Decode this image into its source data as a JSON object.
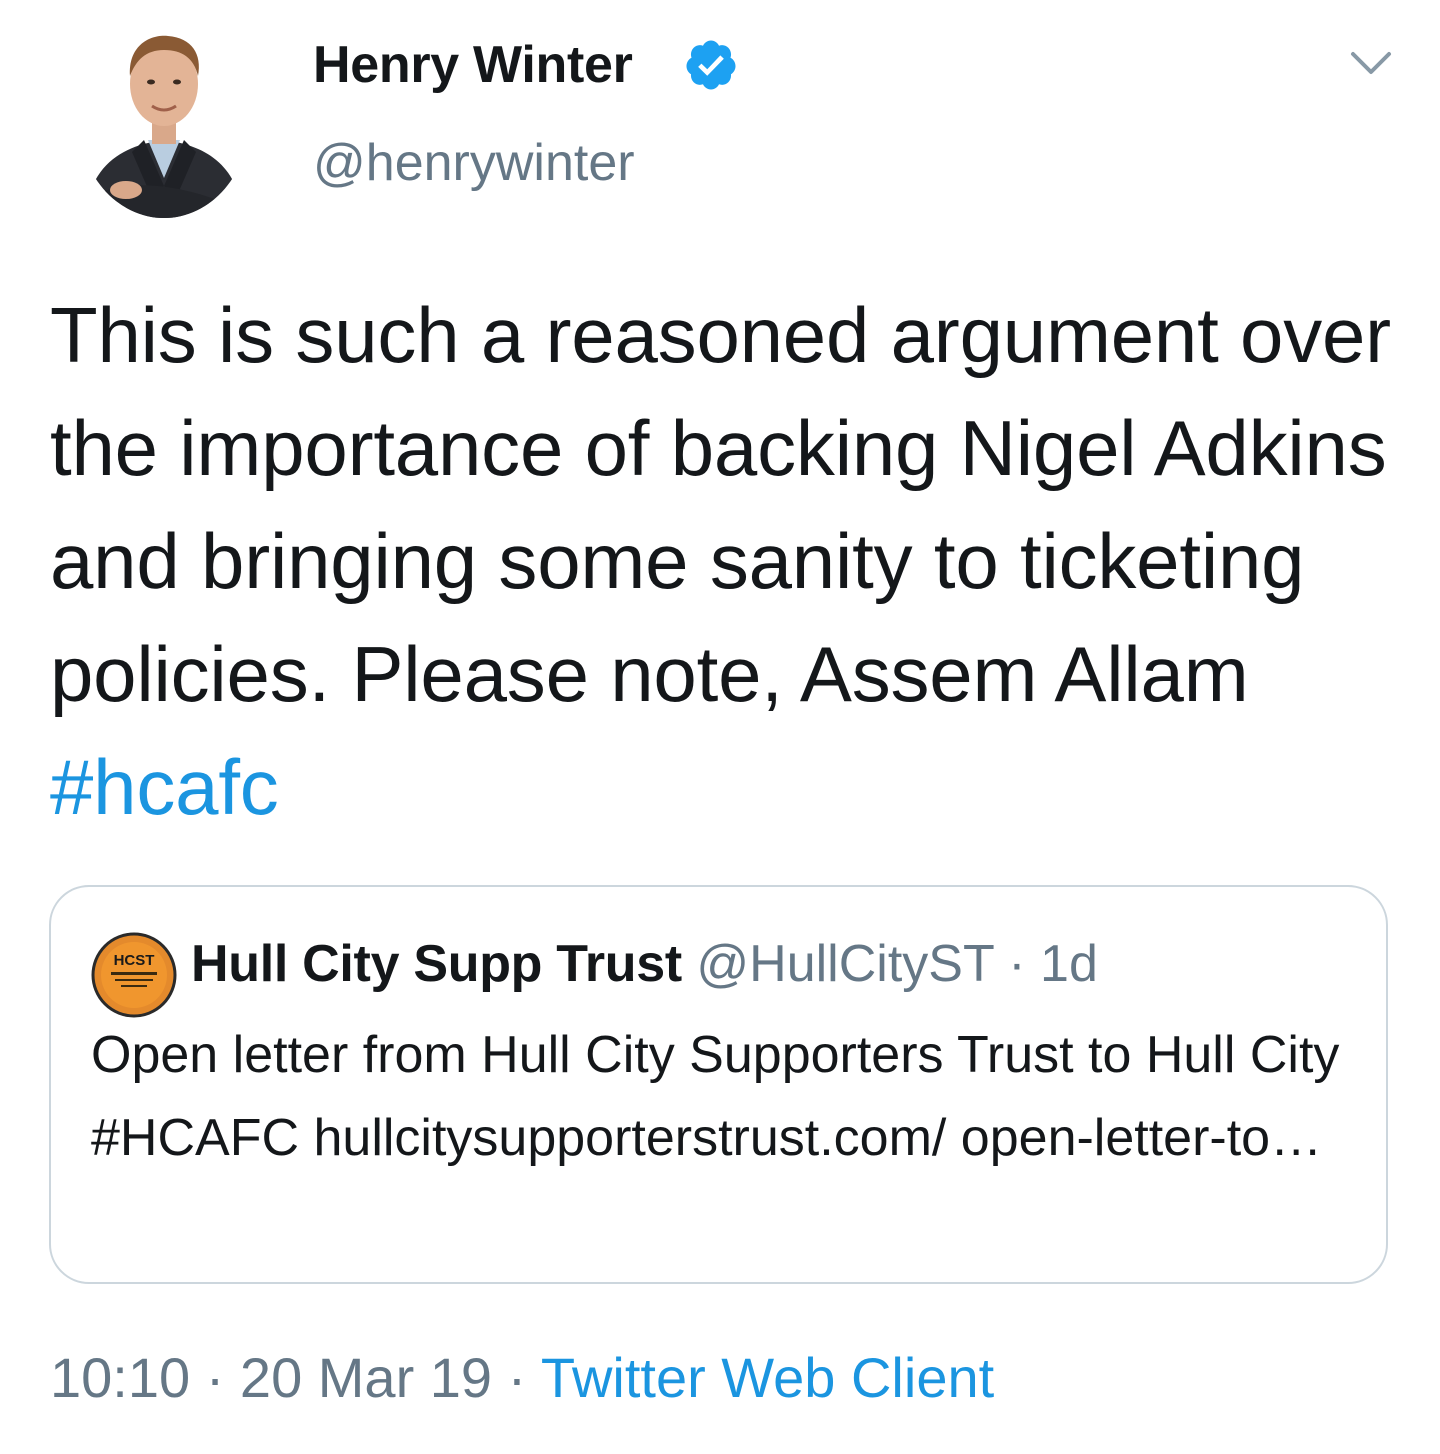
{
  "author": {
    "display_name": "Henry Winter",
    "handle": "@henrywinter",
    "verified": true,
    "avatar_icon": "person-photo-avatar"
  },
  "tweet": {
    "text": "This is such a reasoned argument over the importance of backing Nigel Adkins and bringing some sanity to ticketing policies. Please note, Assem Allam ",
    "hashtag": "#hcafc"
  },
  "quoted_tweet": {
    "display_name": "Hull City Supp Trust",
    "handle": "@HullCityST",
    "separator": "·",
    "time": "1d",
    "avatar_text": "HCST",
    "text": "Open letter from Hull City Supporters Trust to Hull City #HCAFC hullcitysupporterstrust.com/ open-letter-to…"
  },
  "footer": {
    "time": "10:10",
    "dot1": "·",
    "date": "20 Mar 19",
    "dot2": "·",
    "source": "Twitter Web Client"
  },
  "colors": {
    "link": "#1b95e0",
    "muted": "#657786",
    "text": "#14171a",
    "border": "#ccd6dd",
    "verified_badge": "#1da1f2"
  }
}
